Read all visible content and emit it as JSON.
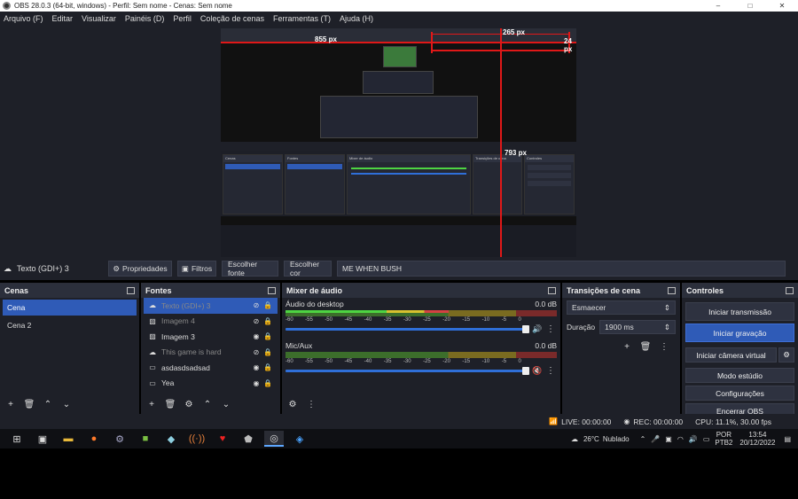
{
  "window": {
    "title": "OBS 28.0.3 (64-bit, windows) - Perfil: Sem nome - Cenas: Sem nome",
    "controls": [
      "–",
      "□",
      "✕"
    ]
  },
  "menu": [
    "Arquivo (F)",
    "Editar",
    "Visualizar",
    "Painéis (D)",
    "Perfil",
    "Coleção de cenas",
    "Ferramentas (T)",
    "Ajuda (H)"
  ],
  "preview": {
    "measures": [
      "855 px",
      "265 px",
      "24 px",
      "793 px"
    ]
  },
  "source_toolbar": {
    "current_source": "Texto (GDI+) 3",
    "properties": "Propriedades",
    "filters": "Filtros",
    "choose_font": "Escolher fonte",
    "choose_color": "Escolher cor",
    "text_value": "ME WHEN BUSH"
  },
  "scenes": {
    "title": "Cenas",
    "items": [
      "Cena",
      "Cena 2"
    ]
  },
  "sources": {
    "title": "Fontes",
    "items": [
      {
        "icon": "cloud-icon",
        "label": "Texto (GDI+) 3"
      },
      {
        "icon": "image-icon",
        "label": "Imagem 4"
      },
      {
        "icon": "image-icon",
        "label": "Imagem 3"
      },
      {
        "icon": "cloud-icon",
        "label": "This game is hard"
      },
      {
        "icon": "window-icon",
        "label": "asdasdsadsad"
      },
      {
        "icon": "monitor-icon",
        "label": "Yea"
      }
    ]
  },
  "mixer": {
    "title": "Mixer de áudio",
    "channels": [
      {
        "name": "Áudio do desktop",
        "db": "0.0 dB"
      },
      {
        "name": "Mic/Aux",
        "db": "0.0 dB"
      }
    ],
    "scale": [
      "-60",
      "-55",
      "-50",
      "-45",
      "-40",
      "-35",
      "-30",
      "-25",
      "-20",
      "-15",
      "-10",
      "-5",
      "0"
    ]
  },
  "transitions": {
    "title": "Transições de cena",
    "selected": "Esmaecer",
    "duration_label": "Duração",
    "duration_value": "1900 ms"
  },
  "controls": {
    "title": "Controles",
    "start_stream": "Iniciar transmissão",
    "start_recording": "Iniciar gravação",
    "start_vcam": "Iniciar câmera virtual",
    "studio_mode": "Modo estúdio",
    "settings": "Configurações",
    "exit": "Encerrar OBS"
  },
  "status": {
    "live": "LIVE: 00:00:00",
    "rec": "REC: 00:00:00",
    "cpu": "CPU: 11.1%, 30.00 fps"
  },
  "taskbar": {
    "weather_temp": "26°C",
    "weather_desc": "Nublado",
    "lang1": "POR",
    "lang2": "PTB2",
    "time": "13:54",
    "date": "20/12/2022"
  }
}
